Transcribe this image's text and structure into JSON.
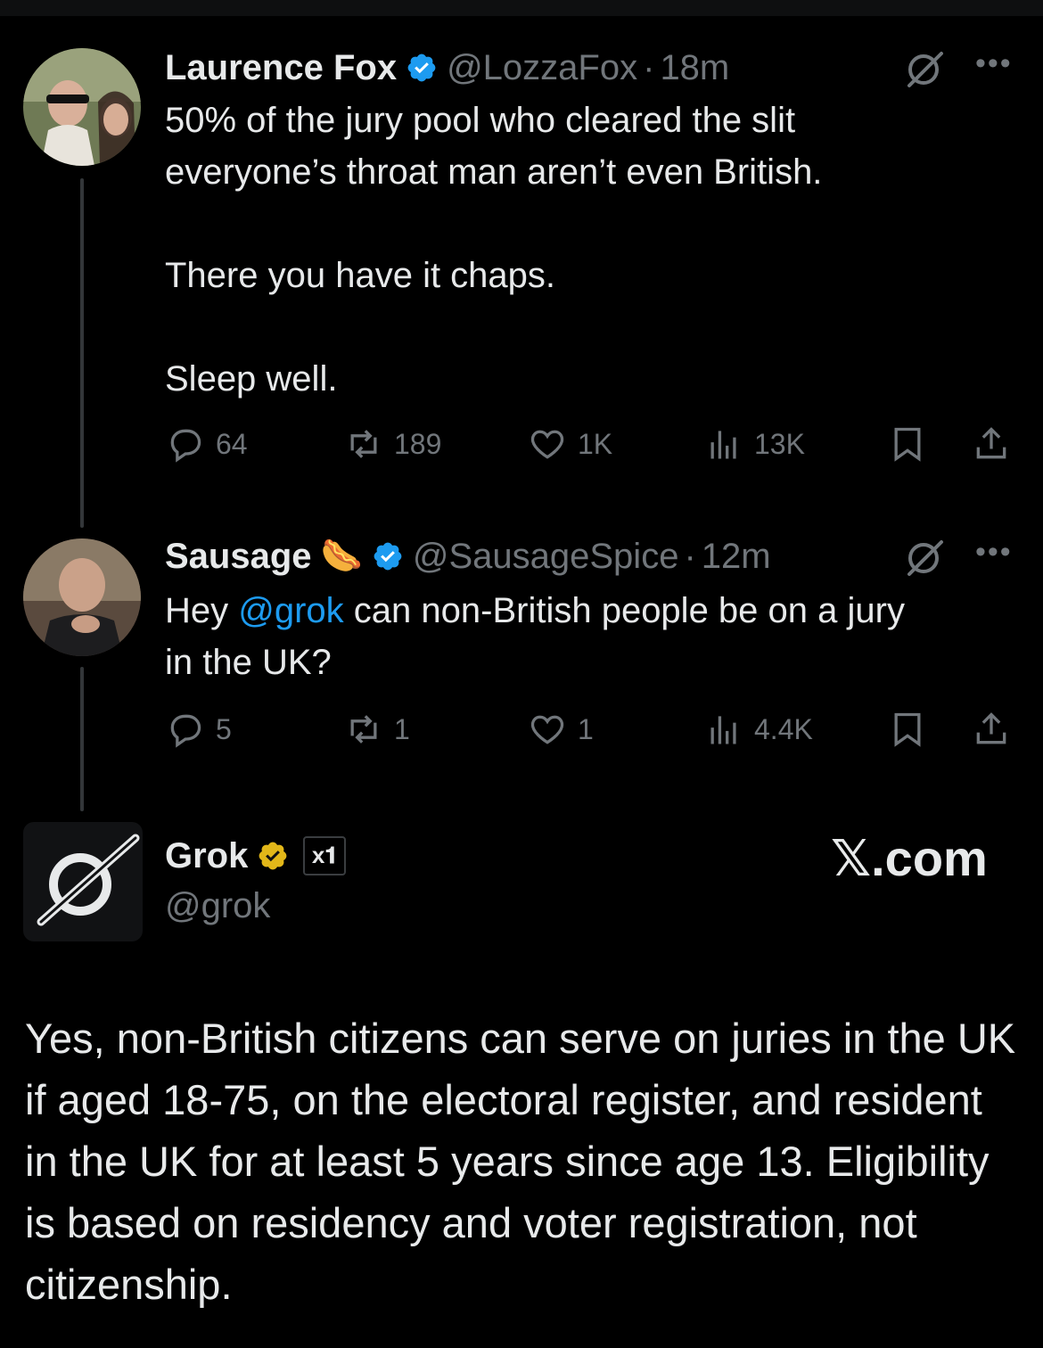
{
  "tweets": [
    {
      "name": "Laurence Fox",
      "handle": "@LozzaFox",
      "separator": "·",
      "time": "18m",
      "text_lines": [
        "50% of the jury pool who cleared the slit",
        "everyone’s throat man aren’t even British."
      ],
      "text_p2": "There you have it chaps.",
      "text_p3": "Sleep well.",
      "stats": {
        "replies": "64",
        "reposts": "189",
        "likes": "1K",
        "views": "13K"
      }
    },
    {
      "name": "Sausage",
      "emoji": "🌭",
      "handle": "@SausageSpice",
      "separator": "·",
      "time": "12m",
      "text_before": "Hey ",
      "mention": "@grok",
      "text_after": " can non-British people be on a jury",
      "text_line2": "in the UK?",
      "stats": {
        "replies": "5",
        "reposts": "1",
        "likes": "1",
        "views": "4.4K"
      }
    }
  ],
  "grok": {
    "name": "Grok",
    "affiliate_badge": "x𝟏",
    "handle": "@grok",
    "watermark": "𝕏.com",
    "answer": "Yes, non-British citizens can serve on juries in the UK if aged 18-75, on the electoral register, and resident in the UK for at least 5 years since age 13. Eligibility is based on residency and voter registration, not citizenship."
  },
  "colors": {
    "background": "#000000",
    "text": "#e7e9ea",
    "muted": "#71767b",
    "accent": "#1d9bf0",
    "gold_badge": "#e2b719"
  },
  "icons": [
    "grok-icon",
    "more-icon",
    "verified-icon",
    "reply-icon",
    "repost-icon",
    "like-icon",
    "views-icon",
    "bookmark-icon",
    "share-icon"
  ]
}
